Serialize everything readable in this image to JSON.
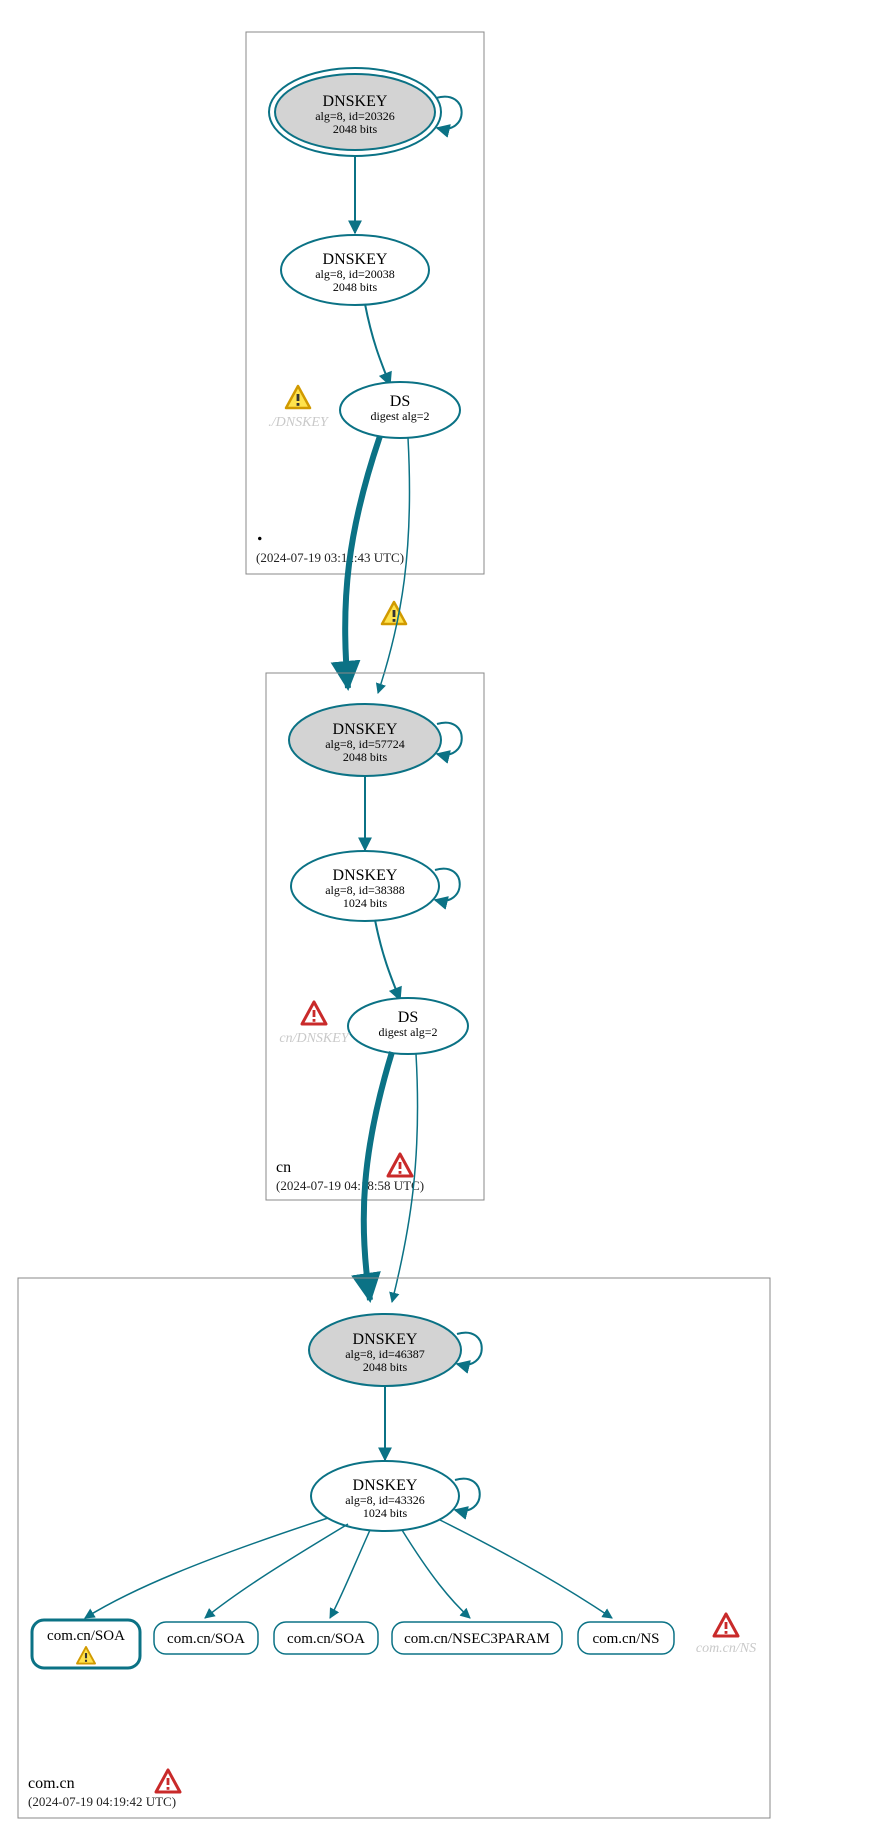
{
  "chart_data": {
    "type": "dnssec_delegation_graph",
    "zones": [
      {
        "name": ".",
        "timestamp": "(2024-07-19 03:12:43 UTC)",
        "nodes": [
          {
            "id": "root_ksk",
            "type": "DNSKEY",
            "label": "DNSKEY",
            "sub1": "alg=8, id=20326",
            "sub2": "2048 bits",
            "ksk": true,
            "trust_anchor": true
          },
          {
            "id": "root_zsk",
            "type": "DNSKEY",
            "label": "DNSKEY",
            "sub1": "alg=8, id=20038",
            "sub2": "2048 bits"
          },
          {
            "id": "root_ds",
            "type": "DS",
            "label": "DS",
            "sub1": "digest alg=2"
          }
        ],
        "ghost": "./DNSKEY",
        "ghost_warn": "yellow"
      },
      {
        "name": "cn",
        "timestamp": "(2024-07-19 04:18:58 UTC)",
        "nodes": [
          {
            "id": "cn_ksk",
            "type": "DNSKEY",
            "label": "DNSKEY",
            "sub1": "alg=8, id=57724",
            "sub2": "2048 bits",
            "ksk": true
          },
          {
            "id": "cn_zsk",
            "type": "DNSKEY",
            "label": "DNSKEY",
            "sub1": "alg=8, id=38388",
            "sub2": "1024 bits"
          },
          {
            "id": "cn_ds",
            "type": "DS",
            "label": "DS",
            "sub1": "digest alg=2"
          }
        ],
        "ghost": "cn/DNSKEY",
        "ghost_warn": "red",
        "box_warn": "red"
      },
      {
        "name": "com.cn",
        "timestamp": "(2024-07-19 04:19:42 UTC)",
        "nodes": [
          {
            "id": "comcn_ksk",
            "type": "DNSKEY",
            "label": "DNSKEY",
            "sub1": "alg=8, id=46387",
            "sub2": "2048 bits",
            "ksk": true
          },
          {
            "id": "comcn_zsk",
            "type": "DNSKEY",
            "label": "DNSKEY",
            "sub1": "alg=8, id=43326",
            "sub2": "1024 bits"
          }
        ],
        "rrsets": [
          {
            "label": "com.cn/SOA",
            "warn": "yellow",
            "thick": true
          },
          {
            "label": "com.cn/SOA"
          },
          {
            "label": "com.cn/SOA"
          },
          {
            "label": "com.cn/NSEC3PARAM"
          },
          {
            "label": "com.cn/NS"
          }
        ],
        "ghost": "com.cn/NS",
        "ghost_warn": "red",
        "box_warn": "red"
      }
    ],
    "edges_between": [
      {
        "from": "root_ds",
        "to": "cn_ksk",
        "warn": "yellow",
        "thick": true
      },
      {
        "from": "cn_ds",
        "to": "comcn_ksk",
        "thick": true
      }
    ]
  },
  "z0_name": ".",
  "z0_time": "(2024-07-19 03:12:43 UTC)",
  "z0_ghost": "./DNSKEY",
  "z0_n0_t": "DNSKEY",
  "z0_n0_s1": "alg=8, id=20326",
  "z0_n0_s2": "2048 bits",
  "z0_n1_t": "DNSKEY",
  "z0_n1_s1": "alg=8, id=20038",
  "z0_n1_s2": "2048 bits",
  "z0_n2_t": "DS",
  "z0_n2_s1": "digest alg=2",
  "z1_name": "cn",
  "z1_time": "(2024-07-19 04:18:58 UTC)",
  "z1_ghost": "cn/DNSKEY",
  "z1_n0_t": "DNSKEY",
  "z1_n0_s1": "alg=8, id=57724",
  "z1_n0_s2": "2048 bits",
  "z1_n1_t": "DNSKEY",
  "z1_n1_s1": "alg=8, id=38388",
  "z1_n1_s2": "1024 bits",
  "z1_n2_t": "DS",
  "z1_n2_s1": "digest alg=2",
  "z2_name": "com.cn",
  "z2_time": "(2024-07-19 04:19:42 UTC)",
  "z2_ghost": "com.cn/NS",
  "z2_n0_t": "DNSKEY",
  "z2_n0_s1": "alg=8, id=46387",
  "z2_n0_s2": "2048 bits",
  "z2_n1_t": "DNSKEY",
  "z2_n1_s1": "alg=8, id=43326",
  "z2_n1_s2": "1024 bits",
  "z2_r0": "com.cn/SOA",
  "z2_r1": "com.cn/SOA",
  "z2_r2": "com.cn/SOA",
  "z2_r3": "com.cn/NSEC3PARAM",
  "z2_r4": "com.cn/NS"
}
